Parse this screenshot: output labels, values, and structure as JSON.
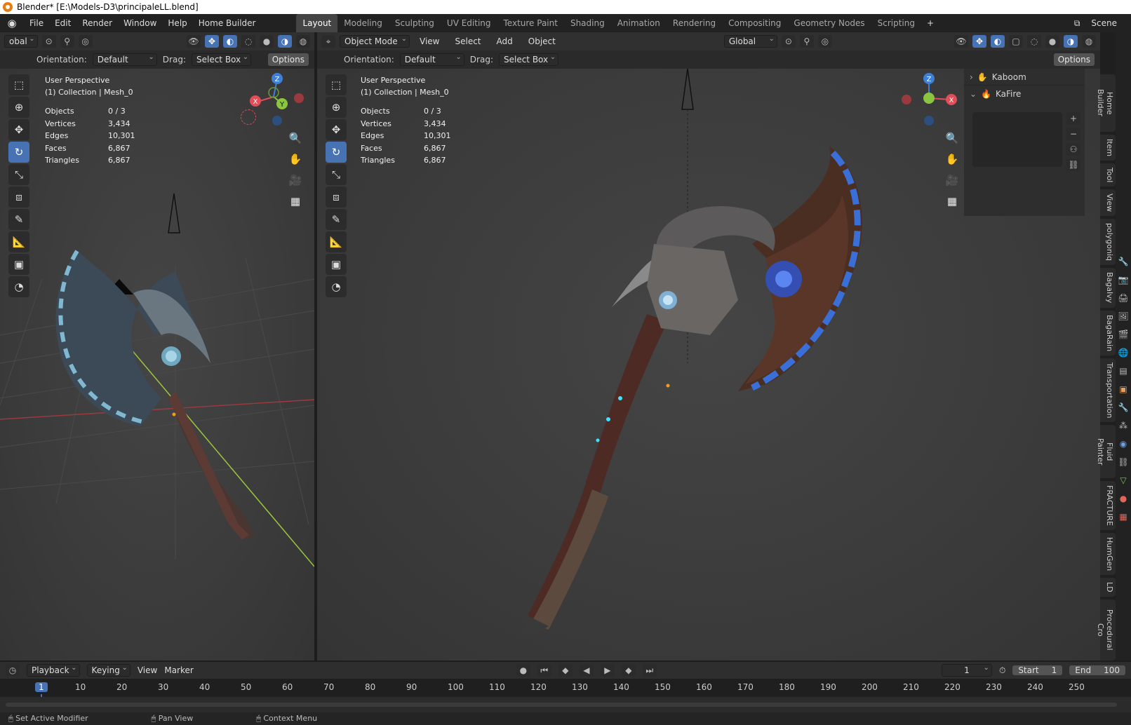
{
  "title_bar": {
    "text": "Blender* [E:\\Models-D3\\principaleLL.blend]"
  },
  "menu": [
    "File",
    "Edit",
    "Render",
    "Window",
    "Help",
    "Home Builder"
  ],
  "workspaces": [
    "Layout",
    "Modeling",
    "Sculpting",
    "UV Editing",
    "Texture Paint",
    "Shading",
    "Animation",
    "Rendering",
    "Compositing",
    "Geometry Nodes",
    "Scripting"
  ],
  "active_workspace": "Layout",
  "scene": {
    "label": "Scene"
  },
  "left_view": {
    "header": {
      "transform": "obal"
    },
    "toolrow": {
      "orientation_label": "Orientation:",
      "orientation_value": "Default",
      "drag_label": "Drag:",
      "drag_value": "Select Box",
      "options": "Options"
    },
    "overlay": {
      "perspective": "User Perspective",
      "collection": "(1) Collection | Mesh_0"
    },
    "stats": [
      {
        "label": "Objects",
        "value": "0 / 3"
      },
      {
        "label": "Vertices",
        "value": "3,434"
      },
      {
        "label": "Edges",
        "value": "10,301"
      },
      {
        "label": "Faces",
        "value": "6,867"
      },
      {
        "label": "Triangles",
        "value": "6,867"
      }
    ]
  },
  "right_view": {
    "header": {
      "mode": "Object Mode",
      "view": "View",
      "select": "Select",
      "add": "Add",
      "object": "Object",
      "transform": "Global"
    },
    "toolrow": {
      "orientation_label": "Orientation:",
      "orientation_value": "Default",
      "drag_label": "Drag:",
      "drag_value": "Select Box",
      "options": "Options"
    },
    "overlay": {
      "perspective": "User Perspective",
      "collection": "(1) Collection | Mesh_0"
    },
    "stats": [
      {
        "label": "Objects",
        "value": "0 / 3"
      },
      {
        "label": "Vertices",
        "value": "3,434"
      },
      {
        "label": "Edges",
        "value": "10,301"
      },
      {
        "label": "Faces",
        "value": "6,867"
      },
      {
        "label": "Triangles",
        "value": "6,867"
      }
    ]
  },
  "n_panel": {
    "panels": [
      "Kaboom",
      "KaFire"
    ],
    "tabs": [
      "Home Builder",
      "Item",
      "Tool",
      "View",
      "polygoniq",
      "BagaIvy",
      "BagaRain",
      "Transportation",
      "Fluid Painter",
      "FRACTURE",
      "HumGen",
      "LD",
      "Procedural Cro"
    ]
  },
  "gizmo": {
    "x": "X",
    "y": "Y",
    "z": "Z"
  },
  "timeline": {
    "playback": "Playback",
    "keying": "Keying",
    "view": "View",
    "marker": "Marker",
    "current_frame": "1",
    "start_label": "Start",
    "start": "1",
    "end_label": "End",
    "end": "100",
    "ticks": [
      "1",
      "10",
      "20",
      "30",
      "40",
      "50",
      "60",
      "70",
      "80",
      "90",
      "100",
      "110",
      "120",
      "130",
      "140",
      "150",
      "160",
      "170",
      "180",
      "190",
      "200",
      "210",
      "220",
      "230",
      "240",
      "250"
    ]
  },
  "status": {
    "left": "Set Active Modifier",
    "mid": "Pan View",
    "right": "Context Menu"
  },
  "colors": {
    "accent": "#4772b3",
    "x_axis": "#e24d5a",
    "y_axis": "#8bc53f",
    "z_axis": "#3f7fd7",
    "frame_marker": "#4772b3"
  }
}
